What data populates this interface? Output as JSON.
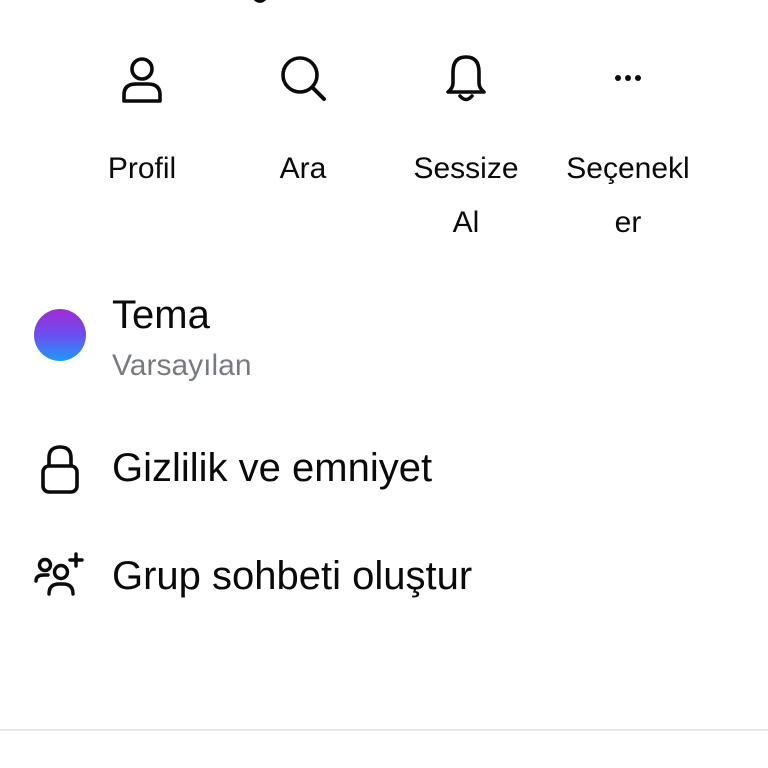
{
  "actions": [
    {
      "label": "Profil",
      "icon": "person-icon"
    },
    {
      "label": "Ara",
      "icon": "search-icon"
    },
    {
      "label": "Sessize Al",
      "icon": "bell-icon"
    },
    {
      "label": "Seçenekler",
      "icon": "more-horizontal-icon"
    }
  ],
  "settings": {
    "theme": {
      "title": "Tema",
      "value": "Varsayılan",
      "icon": "theme-color-dot",
      "gradient": [
        "#a32ad4",
        "#1e9bf6"
      ]
    },
    "privacy": {
      "title": "Gizlilik ve emniyet",
      "icon": "lock-icon"
    },
    "create_group": {
      "title": "Grup sohbeti oluştur",
      "icon": "add-people-icon"
    }
  },
  "colors": {
    "text_primary": "#0a0a0a",
    "text_secondary": "#777b80",
    "divider": "#e4e6e9"
  }
}
